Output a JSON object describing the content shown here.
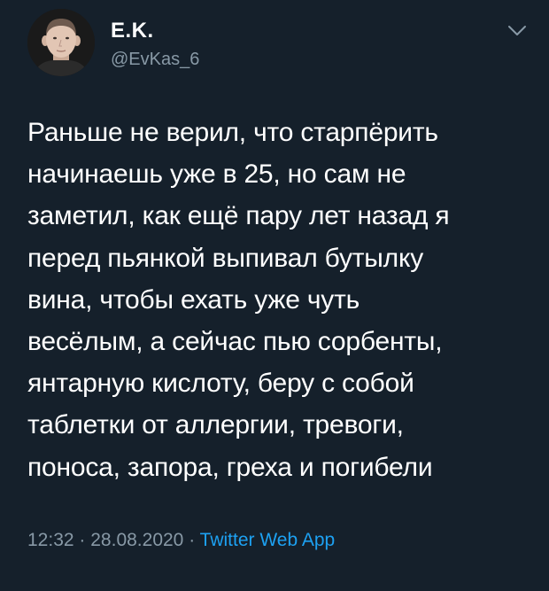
{
  "user": {
    "display_name": "E.K.",
    "handle": "@EvKas_6"
  },
  "tweet": {
    "text": "Раньше не верил, что старпёрить\nначинаешь уже в 25, но сам не\nзаметил, как ещё пару лет назад я\nперед пьянкой выпивал бутылку\nвина, чтобы ехать уже чуть\nвесёлым, а сейчас пью сорбенты,\nянтарную кислоту, беру с собой\nтаблетки от аллергии, тревоги,\nпоноса, запора, греха и погибели"
  },
  "meta": {
    "time": "12:32",
    "separator": "·",
    "date": "28.08.2020",
    "source": "Twitter Web App"
  },
  "icons": {
    "avatar": "avatar-photo",
    "menu": "chevron-down-icon"
  },
  "colors": {
    "background": "#15202b",
    "primary_text": "#ffffff",
    "secondary_text": "#8899a6",
    "link": "#1da1f2"
  }
}
